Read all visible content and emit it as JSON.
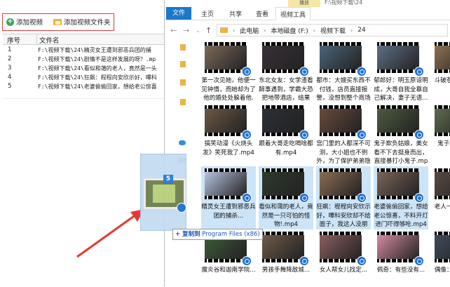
{
  "left_app": {
    "buttons": {
      "add_video": "添加视频",
      "add_video_folder": "添加视频文件夹"
    },
    "columns": {
      "index": "序号",
      "filename": "文件名"
    },
    "rows": [
      {
        "index": "1",
        "path": "F:\\视频下载\\24\\精灵女王遭到邪恶兵团的捕"
      },
      {
        "index": "2",
        "path": "F:\\视频下载\\24\\剧情不是这样发展的呀？.mp"
      },
      {
        "index": "3",
        "path": "F:\\视频下载\\24\\看似和蔼的老人，竟然是一头"
      },
      {
        "index": "4",
        "path": "F:\\视频下载\\24\\狂飙：程程向安欣示好，嗶科"
      },
      {
        "index": "5",
        "path": "F:\\视频下载\\24\\老婆偷偷回家，想给老公惊喜"
      }
    ]
  },
  "explorer": {
    "context_tab": "播放",
    "window_title": "F:\\视频下载\\24",
    "ribbon_tabs": [
      "文件",
      "主页",
      "共享",
      "查看",
      "视频工具"
    ],
    "breadcrumb": [
      "此电脑",
      "本地磁盘 (F:)",
      "视频下载",
      "24"
    ],
    "icons": {
      "back": "arrow-left-icon",
      "forward": "arrow-right-icon",
      "recent": "chevron-down-icon",
      "up": "arrow-up-icon"
    }
  },
  "files": [
    {
      "label": "第一次见她，他便一见钟情，而她却为了他的婚处处躲着他.mp4",
      "color": "#7a6a5a",
      "sel": false
    },
    {
      "label": "东北女友：女学渣看醉事遇到，学霸大恐把地带酒店，结果完...",
      "color": "#3a3038",
      "sel": false
    },
    {
      "label": "都市：大嫂买东西不付钱，店员直接报警，没想到整个商场都是...",
      "color": "#4a6478",
      "sel": false
    },
    {
      "label": "郁郎好：明玉原谅明成，大哥自我全靠自己解决，妻子无语...",
      "color": "#5e6f84",
      "sel": false
    },
    {
      "label": "斗破苍穹：卖开元丽...",
      "color": "#8c7152",
      "sel": false
    },
    {
      "label": "搞笑动漫《火烧头发》笑死我了.mp4",
      "color": "#6b5844",
      "sel": false
    },
    {
      "label": "跟着大哥走吃喝啥都有.mp4",
      "color": "#2c2f38",
      "sel": false
    },
    {
      "label": "宫门里的人都深不可测，大小姐也不例外，为了保护弟弟隐藏...",
      "color": "#6a4a3c",
      "sel": false
    },
    {
      "label": "鬼子欺负姑娘，美女看不下去挺身而出，直接暴打小鬼子.mp4",
      "color": "#4d5b3f",
      "sel": false
    },
    {
      "label": "鬼子欺八路兄...",
      "color": "#5d6a4e",
      "sel": false
    },
    {
      "label": "精灵女王遭到邪恶兵团的捕杀...",
      "color": "#b6c3e0",
      "sel": true
    },
    {
      "label": "看似和蔼的老人，竟然是一只可怕的怪物!.mp4",
      "color": "#2e3a2e",
      "sel": true
    },
    {
      "label": "狂飙：程程向安欣示好，嗶科安欣却不给面子，我这人没朋友...",
      "color": "#8a6d55",
      "sel": true
    },
    {
      "label": "老婆偷偷回家，想给老公惊喜，不料开灯进门吓得够呛.mp4",
      "color": "#7a6458",
      "sel": true
    },
    {
      "label": "老人一辈子被人摇摇...",
      "color": "#5a4a42",
      "sel": false
    },
    {
      "label": "魔炎谷和迦南学院...",
      "color": "#3f5c3a",
      "sel": false
    },
    {
      "label": "男孩手舞降敌城...",
      "color": "#6e5a4a",
      "sel": false
    },
    {
      "label": "女人帮女儿找定...",
      "color": "#8b5e5e",
      "sel": false
    },
    {
      "label": "佩奇：有些没有...",
      "color": "#d58aa0",
      "sel": false
    },
    {
      "label": "偶像：有充没充...",
      "color": "#3e4a5a",
      "sel": false
    }
  ],
  "drag": {
    "count": "5",
    "tooltip_action": "+ 复制到",
    "tooltip_dest": "Program Files (x86)"
  }
}
